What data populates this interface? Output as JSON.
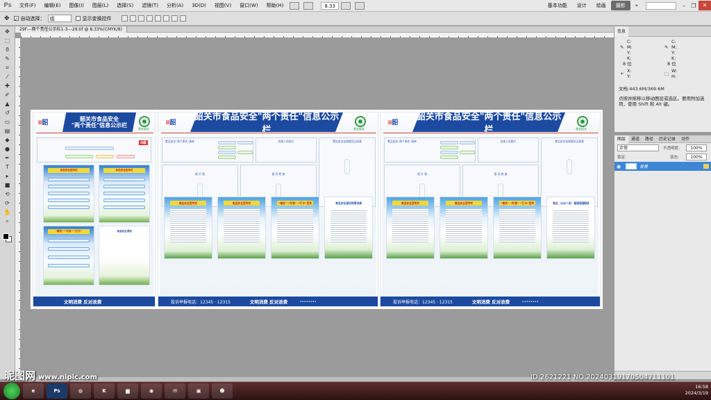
{
  "app": {
    "logo": "Ps",
    "menus": [
      "文件(F)",
      "编辑(E)",
      "图像(I)",
      "图层(L)",
      "选择(S)",
      "滤镜(T)",
      "分析(A)",
      "3D(D)",
      "视图(V)",
      "窗口(W)",
      "帮助(H)"
    ],
    "zoom": "8.33",
    "workspaces": [
      "基本功能",
      "设计",
      "绘画",
      "摄影"
    ],
    "active_workspace": "摄影",
    "more": "»"
  },
  "options_bar": {
    "auto_select_label": "自动选择：",
    "auto_select_value": "组",
    "show_transform_label": "显示变换控件"
  },
  "document": {
    "tab_title": "29F---两个责任公示栏1-3---29.tif @ 8.33%(CMYK/8)"
  },
  "artwork": {
    "left_panel": {
      "title_line1": "韶关市食品安全",
      "title_line2": "\"两个责任\"信息公示栏",
      "grade": "A级",
      "posters": [
        "食品安全宣传栏",
        "食品安全宣传栏",
        "“餐饮”·“时食”·“打卡”",
        "食品安全须知"
      ]
    },
    "main_title": "韶关市食品安全\"两个责任\"信息公示栏",
    "logo_right_caption": "食安韶关",
    "panel_captions": [
      "食品安全“两个责任”清单",
      "包保人员照片",
      "食品安全包保督导记录表"
    ],
    "inner_frames": [
      "照 片 墙",
      "督 导 检 查"
    ],
    "posters_mid": [
      "食品安全宣传栏",
      "食品安全宣传栏",
      "“餐饮”·“时食”·“打卡”宣传",
      "食品安全相关政策法律"
    ],
    "posters_right": [
      "食品安全宣传栏",
      "食品安全宣传栏",
      "“餐饮”·“时食”·“打卡”宣传",
      "食品（从业人员）健康管理制度"
    ],
    "footer": {
      "hotline": "投诉举报电话：12345 · 12315",
      "motto": "文明消费  反对浪费"
    }
  },
  "info_panel": {
    "tabs": [
      "信息"
    ],
    "c_label": "C:",
    "m_label": "M:",
    "y_label": "Y:",
    "k_label": "K:",
    "bits": "8 位",
    "x_label": "X:",
    "y2_label": "Y:",
    "w_label": "W:",
    "h_label": "H:",
    "doc_size": "文档:443.6M/369.6M",
    "hint": "点按并拖移以移动图层或选区。要用附加选项，使用 Shift 和 Alt 键。"
  },
  "layers_panel": {
    "tabs": [
      "图层",
      "通道",
      "路径",
      "历史记录",
      "动作"
    ],
    "active_tab": "图层",
    "blend_mode": "正常",
    "opacity_label": "不透明度:",
    "opacity": "100%",
    "lock_label": "锁定:",
    "fill_label": "填充:",
    "fill": "100%",
    "layer_name": "背景"
  },
  "taskbar": {
    "watermark": "昵图网",
    "watermark_url": "www.nipic.com",
    "image_id": "ID:2621221 NO:20240319170504711101",
    "apps": [
      "Ps",
      "Ps"
    ],
    "time": "16:58",
    "date": "2024/3/19"
  },
  "colors": {
    "brand_blue": "#1c4aa0",
    "accent_red": "#c23a2a",
    "poster_yellow": "#f2d93a"
  }
}
